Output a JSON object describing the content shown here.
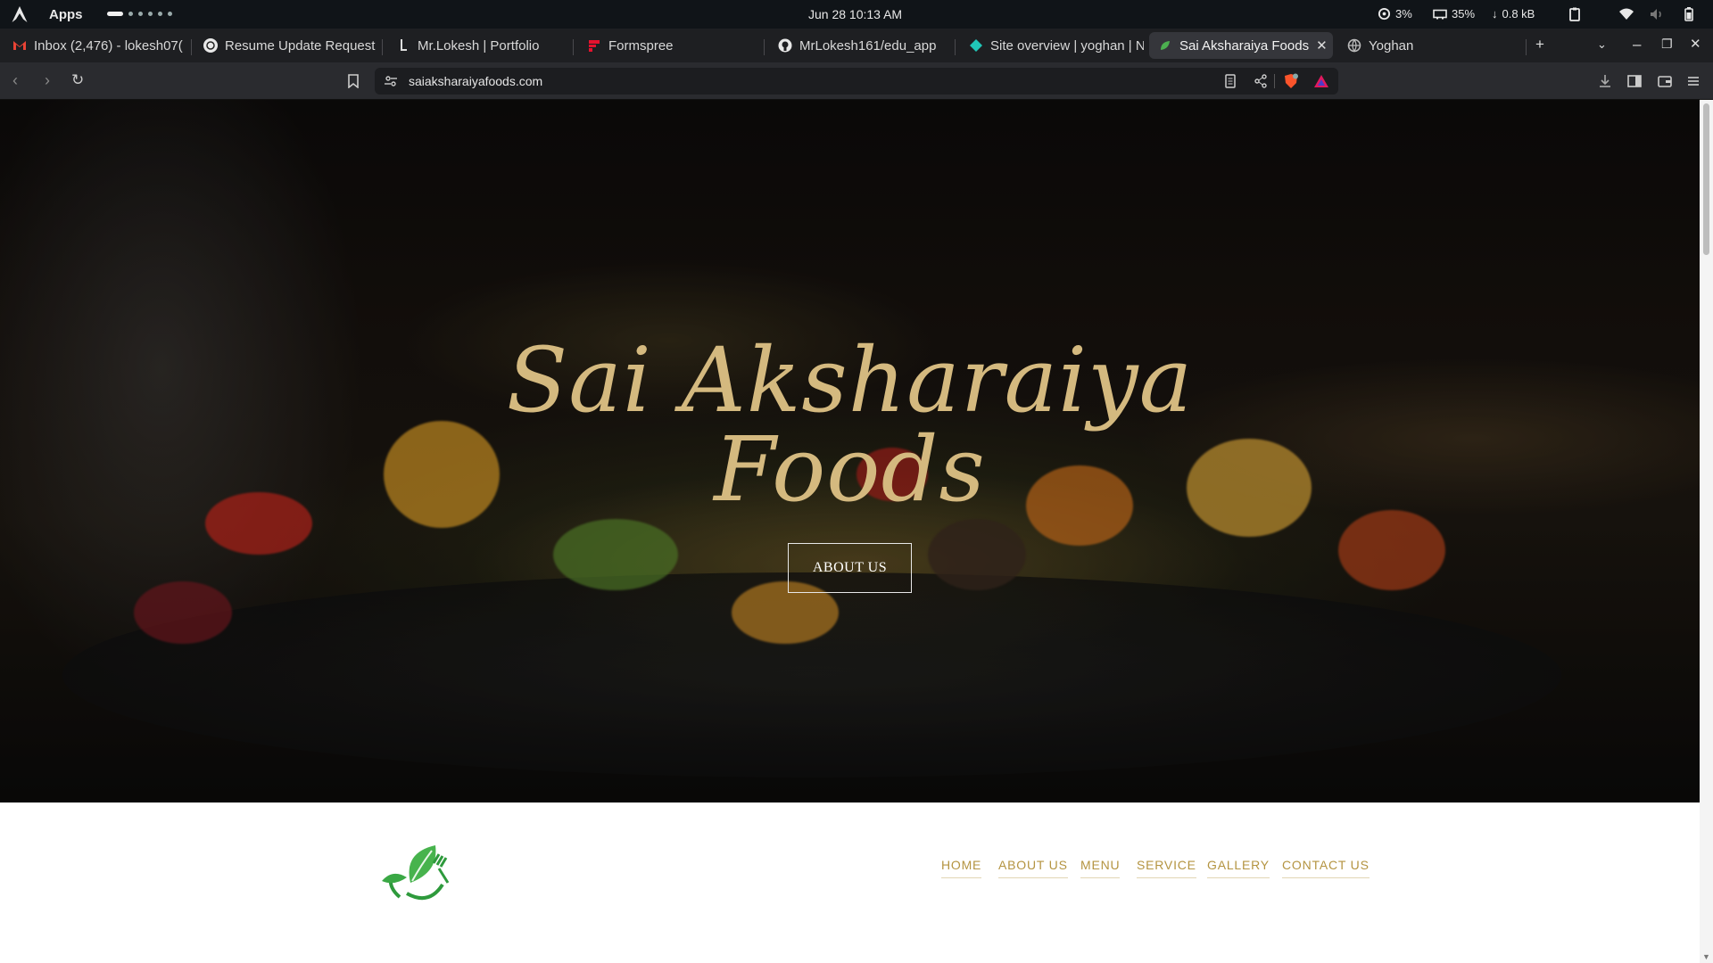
{
  "system": {
    "apps_label": "Apps",
    "clock": "Jun 28  10:13 AM",
    "cpu": "3%",
    "memory": "35%",
    "network": "0.8 kB"
  },
  "tabs": [
    {
      "title": "Inbox (2,476) - lokesh07(",
      "icon": "gmail-icon",
      "active": false
    },
    {
      "title": "Resume Update Request",
      "icon": "openai-icon",
      "active": false
    },
    {
      "title": "Mr.Lokesh | Portfolio",
      "icon": "portfolio-icon",
      "active": false
    },
    {
      "title": "Formspree",
      "icon": "formspree-icon",
      "active": false
    },
    {
      "title": "MrLokesh161/edu_app",
      "icon": "github-icon",
      "active": false
    },
    {
      "title": "Site overview | yoghan | N",
      "icon": "netlify-icon",
      "active": false
    },
    {
      "title": "Sai Aksharaiya Foods",
      "icon": "leaf-icon",
      "active": true
    },
    {
      "title": "Yoghan",
      "icon": "globe-icon",
      "active": false
    }
  ],
  "address_bar": {
    "url": "saiaksharaiyafoods.com"
  },
  "hero": {
    "title_line1": "Sai Aksharaiya",
    "title_line2": "Foods",
    "button_label": "ABOUT US"
  },
  "nav": {
    "items": [
      "HOME",
      "ABOUT US",
      "MENU",
      "SERVICE",
      "GALLERY",
      "CONTACT US"
    ]
  },
  "colors": {
    "accent_gold": "#b49441",
    "hero_title": "#d4b97f",
    "logo_green": "#3aa845"
  }
}
